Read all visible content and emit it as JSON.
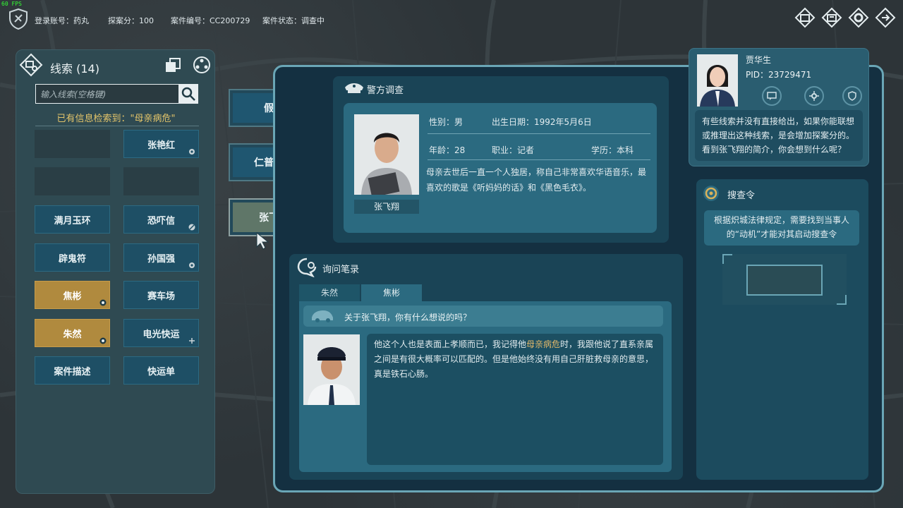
{
  "fps": "60 FPS",
  "topbar": {
    "account_label": "登录账号：药丸",
    "score_label": "探案分：100",
    "case_id_label": "案件编号：CC200729",
    "case_status_label": "案件状态：调查中",
    "icons": [
      "window-icon",
      "dossier-icon",
      "settings-gear-icon",
      "exit-icon"
    ]
  },
  "clues": {
    "title": "线索 (14)",
    "search_placeholder": "输入线索(空格键)",
    "hint_prefix": "已有信息检索到：",
    "hint_term": "\"母亲病危\"",
    "items": [
      {
        "label": "",
        "style": "empty"
      },
      {
        "label": "张艳红",
        "style": "normal"
      },
      {
        "label": "",
        "style": "empty"
      },
      {
        "label": "",
        "style": "empty"
      },
      {
        "label": "满月玉环",
        "style": "normal"
      },
      {
        "label": "恐吓信",
        "style": "normal"
      },
      {
        "label": "辟鬼符",
        "style": "normal"
      },
      {
        "label": "孙国强",
        "style": "normal"
      },
      {
        "label": "焦彬",
        "style": "gold"
      },
      {
        "label": "赛车场",
        "style": "normal"
      },
      {
        "label": "朱然",
        "style": "gold"
      },
      {
        "label": "电光快运",
        "style": "normal"
      },
      {
        "label": "案件描述",
        "style": "normal"
      },
      {
        "label": "快运单",
        "style": "normal"
      }
    ]
  },
  "clue_tabs": [
    "假药",
    "仁普医院",
    "张飞翔"
  ],
  "police": {
    "header": "警方调查",
    "name": "张飞翔",
    "gender": "性别：男",
    "birth": "出生日期：1992年5月6日",
    "age": "年龄：28",
    "job": "职业：记者",
    "edu": "学历：本科",
    "desc": "母亲去世后一直一个人独居，称自己非常喜欢华语音乐，最喜欢的歌是《听妈妈的话》和《黑色毛衣》。"
  },
  "inquiry": {
    "header": "询问笔录",
    "tabs": [
      "朱然",
      "焦彬"
    ],
    "question": "关于张飞翔，你有什么想说的吗？",
    "answer_before": "他这个人也是表面上孝顺而已，我记得他",
    "answer_highlight": "母亲病危",
    "answer_after": "时，我跟他说了直系亲属之间是有很大概率可以匹配的。但是他始终没有用自己肝脏救母亲的意思，真是铁石心肠。"
  },
  "profile": {
    "name": "贾华生",
    "pid": "PID：23729471",
    "tip": "有些线索并没有直接给出，如果你能联想或推理出这种线索，是会增加探案分的。看到张飞翔的简介，你会想到什么呢？"
  },
  "warrant": {
    "header": "搜查令",
    "tip": "根据炽城法律规定，需要找到当事人的“动机”才能对其启动搜查令"
  },
  "colors": {
    "accent": "#6aa6b6",
    "gold": "#b08a3e",
    "highlight": "#e3c46a"
  }
}
